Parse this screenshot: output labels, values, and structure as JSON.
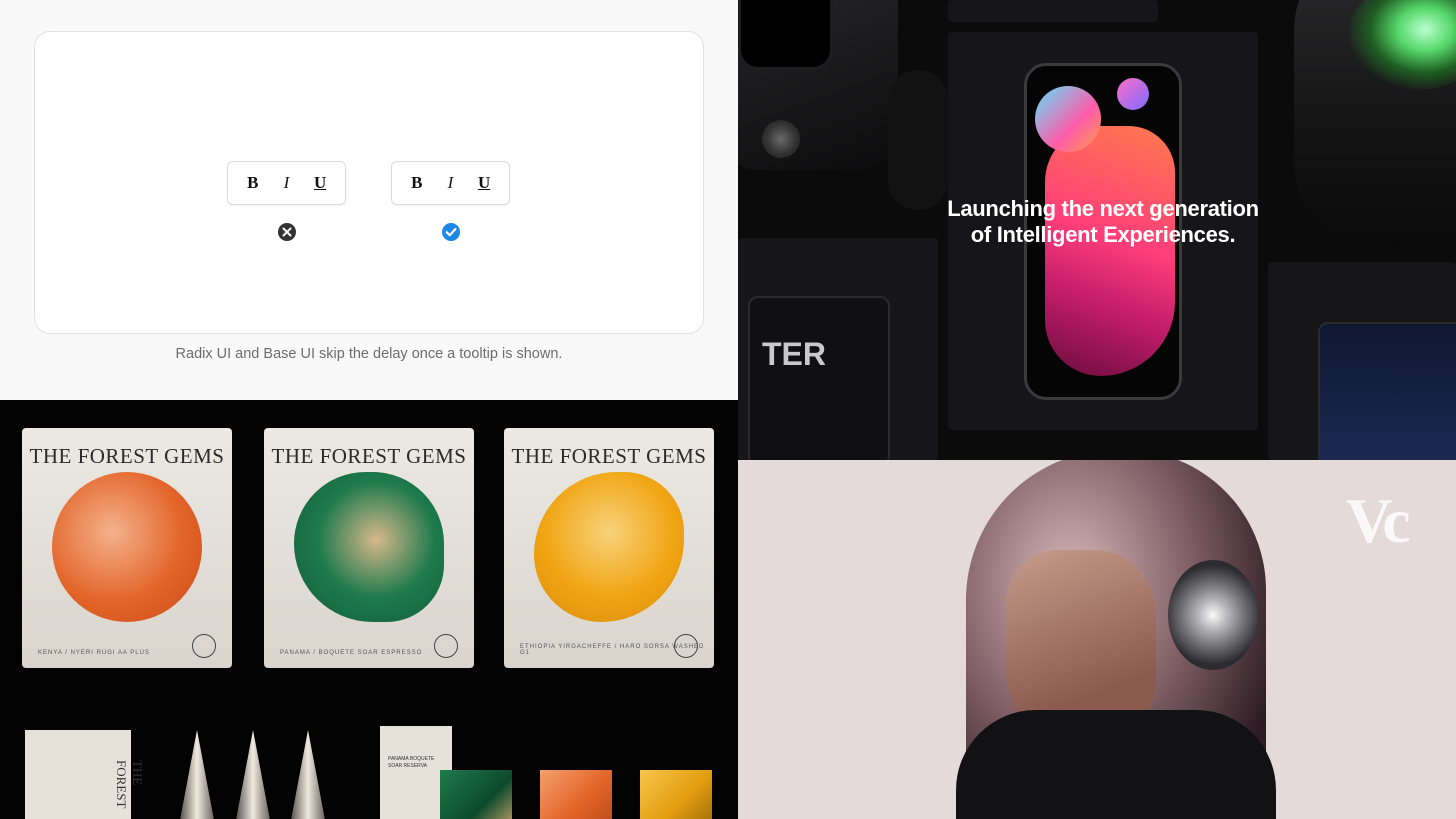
{
  "tooltip_demo": {
    "left_toolbar": {
      "bold": "B",
      "italic": "I",
      "underline": "U"
    },
    "right_toolbar": {
      "bold": "B",
      "italic": "I",
      "underline": "U"
    },
    "left_status": "close-circle-icon",
    "right_status": "check-circle-icon",
    "caption": "Radix UI and Base UI skip the delay once a tooltip is shown.",
    "colors": {
      "check": "#1e88e5",
      "close": "#333333",
      "border": "#e2e2e2"
    }
  },
  "devices_showcase": {
    "headline_line1": "Launching the next generation",
    "headline_line2": "of Intelligent Experiences.",
    "tablet_text": "TER"
  },
  "packaging": {
    "pouches": [
      {
        "title": "THE FOREST GEMS",
        "subtitle": "KENYA / NYERI RUGI AA PLUS",
        "color": "#e3652a"
      },
      {
        "title": "THE FOREST GEMS",
        "subtitle": "PANAMA / BOQUETE SOAR ESPRESSO",
        "color": "#1e7a4d"
      },
      {
        "title": "THE FOREST GEMS",
        "subtitle": "ETHIOPIA YIRGACHEFFE / HARO SORSA WASHED G1",
        "color": "#f1a514"
      }
    ],
    "box_text": "THE FOREST",
    "card_text": "PANAMA BOQUETE SOAR RESERVA"
  },
  "portrait": {
    "logo": "Vc"
  }
}
